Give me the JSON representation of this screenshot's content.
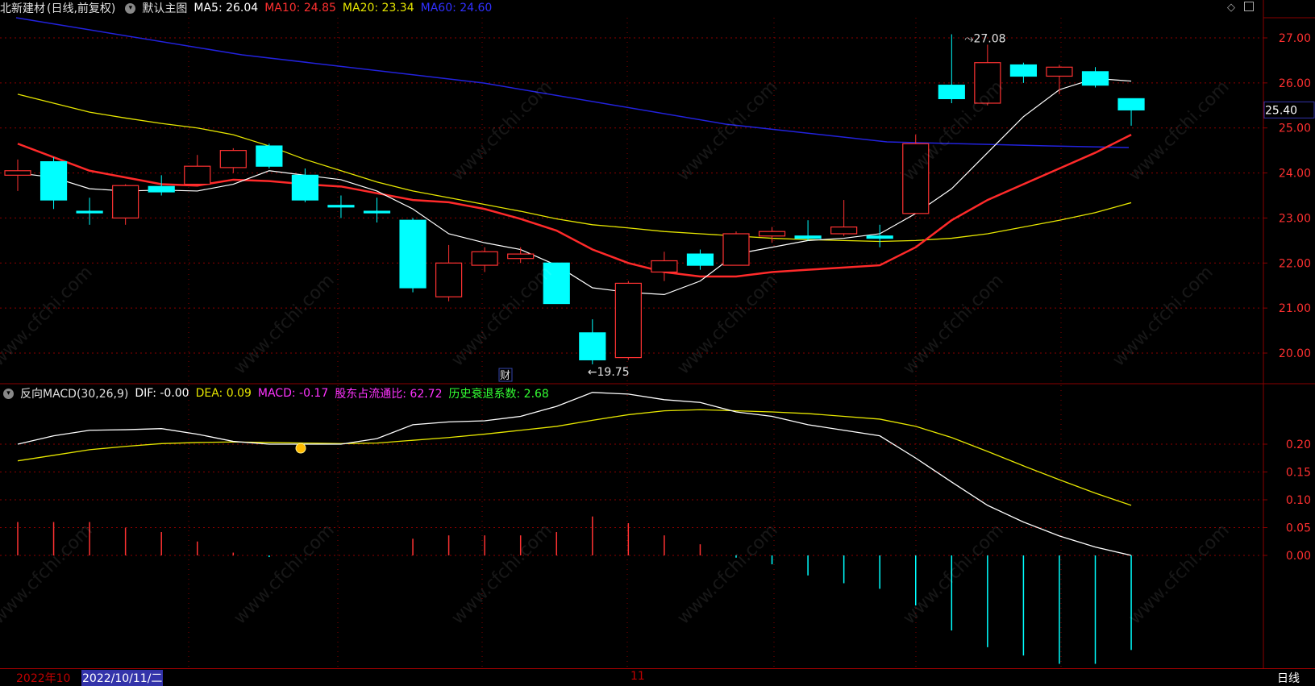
{
  "title_bar": {
    "stock": "北新建材",
    "mode": "(日线,前复权)",
    "template": "默认主图",
    "ma5": "MA5: 26.04",
    "ma10": "MA10: 24.85",
    "ma20": "MA20: 23.34",
    "ma60": "MA60: 24.60"
  },
  "macd_bar": {
    "name": "反向MACD(30,26,9)",
    "dif": "DIF: -0.00",
    "dea": "DEA: 0.09",
    "macd": "MACD: -0.17",
    "ratio": "股东占流通比: 62.72",
    "recession": "历史衰退系数: 2.68"
  },
  "price_axis": [
    "27.00",
    "26.00",
    "25.00",
    "24.00",
    "23.00",
    "22.00",
    "21.00",
    "20.00"
  ],
  "price_current": "25.40",
  "macd_axis": [
    "0.20",
    "0.15",
    "0.10",
    "0.05",
    "0.00"
  ],
  "annotations": {
    "high": "27.08",
    "low": "19.75",
    "fin_marker": "财"
  },
  "bottom": {
    "year": "2022年10",
    "date": "2022/10/11/二",
    "month": "11",
    "period": "日线"
  },
  "watermark": "www.cfchi.com",
  "colors": {
    "up": "#ff3232",
    "down": "#00ffff",
    "ma5": "#ffffff",
    "ma10": "#ff2a2a",
    "ma20": "#e6e600",
    "ma60": "#2222dd",
    "dea": "#e6e600",
    "grid": "#8a0000"
  },
  "chart_data": {
    "type": "candlestick",
    "candles": [
      {
        "o": 23.95,
        "c": 24.05,
        "h": 24.3,
        "l": 23.6
      },
      {
        "o": 24.25,
        "c": 23.4,
        "h": 24.35,
        "l": 23.2
      },
      {
        "o": 23.15,
        "c": 23.12,
        "h": 23.45,
        "l": 22.85
      },
      {
        "o": 23.0,
        "c": 23.72,
        "h": 23.75,
        "l": 22.85
      },
      {
        "o": 23.7,
        "c": 23.58,
        "h": 23.95,
        "l": 23.5
      },
      {
        "o": 23.75,
        "c": 24.15,
        "h": 24.4,
        "l": 23.75
      },
      {
        "o": 24.12,
        "c": 24.5,
        "h": 24.55,
        "l": 24.0
      },
      {
        "o": 24.6,
        "c": 24.15,
        "h": 24.65,
        "l": 24.1
      },
      {
        "o": 23.95,
        "c": 23.4,
        "h": 24.1,
        "l": 23.35
      },
      {
        "o": 23.28,
        "c": 23.25,
        "h": 23.5,
        "l": 23.0
      },
      {
        "o": 23.15,
        "c": 23.12,
        "h": 23.45,
        "l": 22.9
      },
      {
        "o": 22.95,
        "c": 21.45,
        "h": 23.0,
        "l": 21.35
      },
      {
        "o": 21.25,
        "c": 22.0,
        "h": 22.4,
        "l": 21.15
      },
      {
        "o": 21.95,
        "c": 22.25,
        "h": 22.35,
        "l": 21.8
      },
      {
        "o": 22.1,
        "c": 22.2,
        "h": 22.35,
        "l": 22.0
      },
      {
        "o": 22.0,
        "c": 21.1,
        "h": 22.0,
        "l": 21.1
      },
      {
        "o": 20.45,
        "c": 19.85,
        "h": 20.75,
        "l": 19.75
      },
      {
        "o": 19.9,
        "c": 21.55,
        "h": 21.6,
        "l": 19.85
      },
      {
        "o": 21.8,
        "c": 22.05,
        "h": 22.25,
        "l": 21.6
      },
      {
        "o": 22.2,
        "c": 21.95,
        "h": 22.3,
        "l": 21.85
      },
      {
        "o": 21.95,
        "c": 22.65,
        "h": 22.7,
        "l": 21.95
      },
      {
        "o": 22.6,
        "c": 22.7,
        "h": 22.8,
        "l": 22.45
      },
      {
        "o": 22.6,
        "c": 22.55,
        "h": 22.95,
        "l": 22.5
      },
      {
        "o": 22.65,
        "c": 22.8,
        "h": 23.4,
        "l": 22.6
      },
      {
        "o": 22.6,
        "c": 22.55,
        "h": 22.85,
        "l": 22.35
      },
      {
        "o": 23.1,
        "c": 24.65,
        "h": 24.85,
        "l": 23.1
      },
      {
        "o": 25.95,
        "c": 25.65,
        "h": 27.08,
        "l": 25.55
      },
      {
        "o": 25.55,
        "c": 26.45,
        "h": 26.85,
        "l": 25.5
      },
      {
        "o": 26.4,
        "c": 26.15,
        "h": 26.45,
        "l": 26.0
      },
      {
        "o": 26.15,
        "c": 26.35,
        "h": 26.4,
        "l": 25.75
      },
      {
        "o": 26.25,
        "c": 25.95,
        "h": 26.35,
        "l": 25.9
      },
      {
        "o": 25.65,
        "c": 25.4,
        "h": 25.65,
        "l": 25.05
      }
    ],
    "ma5": [
      24.0,
      23.9,
      23.65,
      23.6,
      23.62,
      23.6,
      23.75,
      24.05,
      23.95,
      23.85,
      23.6,
      23.2,
      22.65,
      22.45,
      22.3,
      21.95,
      21.45,
      21.35,
      21.3,
      21.6,
      22.2,
      22.35,
      22.5,
      22.55,
      22.65,
      23.1,
      23.65,
      24.45,
      25.25,
      25.85,
      26.1,
      26.04
    ],
    "ma10": [
      24.65,
      24.35,
      24.05,
      23.9,
      23.75,
      23.72,
      23.85,
      23.82,
      23.75,
      23.7,
      23.55,
      23.4,
      23.35,
      23.2,
      22.98,
      22.72,
      22.3,
      22.0,
      21.8,
      21.7,
      21.7,
      21.8,
      21.85,
      21.9,
      21.95,
      22.35,
      22.95,
      23.4,
      23.75,
      24.1,
      24.45,
      24.85
    ],
    "ma20": [
      25.75,
      25.55,
      25.35,
      25.22,
      25.1,
      25.0,
      24.85,
      24.6,
      24.3,
      24.05,
      23.8,
      23.6,
      23.45,
      23.3,
      23.15,
      22.98,
      22.85,
      22.78,
      22.7,
      22.65,
      22.6,
      22.55,
      22.52,
      22.5,
      22.48,
      22.5,
      22.55,
      22.65,
      22.8,
      22.95,
      23.12,
      23.34
    ],
    "ma60_end": [
      27.4,
      24.6
    ],
    "dif": [
      0.2,
      0.215,
      0.225,
      0.226,
      0.228,
      0.218,
      0.205,
      0.2,
      0.2,
      0.2,
      0.21,
      0.235,
      0.24,
      0.242,
      0.25,
      0.268,
      0.293,
      0.29,
      0.28,
      0.275,
      0.258,
      0.25,
      0.235,
      0.225,
      0.215,
      0.175,
      0.132,
      0.09,
      0.06,
      0.035,
      0.015,
      0.0
    ],
    "dea": [
      0.17,
      0.18,
      0.19,
      0.196,
      0.201,
      0.203,
      0.204,
      0.203,
      0.202,
      0.201,
      0.202,
      0.207,
      0.212,
      0.218,
      0.225,
      0.232,
      0.243,
      0.253,
      0.26,
      0.262,
      0.26,
      0.258,
      0.255,
      0.25,
      0.245,
      0.232,
      0.212,
      0.187,
      0.161,
      0.136,
      0.112,
      0.09
    ],
    "macd": [
      0.06,
      0.06,
      0.06,
      0.05,
      0.042,
      0.025,
      0.005,
      -0.003,
      0.0,
      0.0,
      0.0,
      0.03,
      0.036,
      0.036,
      0.036,
      0.042,
      0.07,
      0.058,
      0.036,
      0.02,
      -0.004,
      -0.016,
      -0.036,
      -0.05,
      -0.06,
      -0.09,
      -0.135,
      -0.165,
      -0.18,
      -0.195,
      -0.195,
      -0.17
    ],
    "ylim_price": [
      19.5,
      27.5
    ],
    "ylim_macd": [
      -0.2,
      0.3
    ]
  }
}
